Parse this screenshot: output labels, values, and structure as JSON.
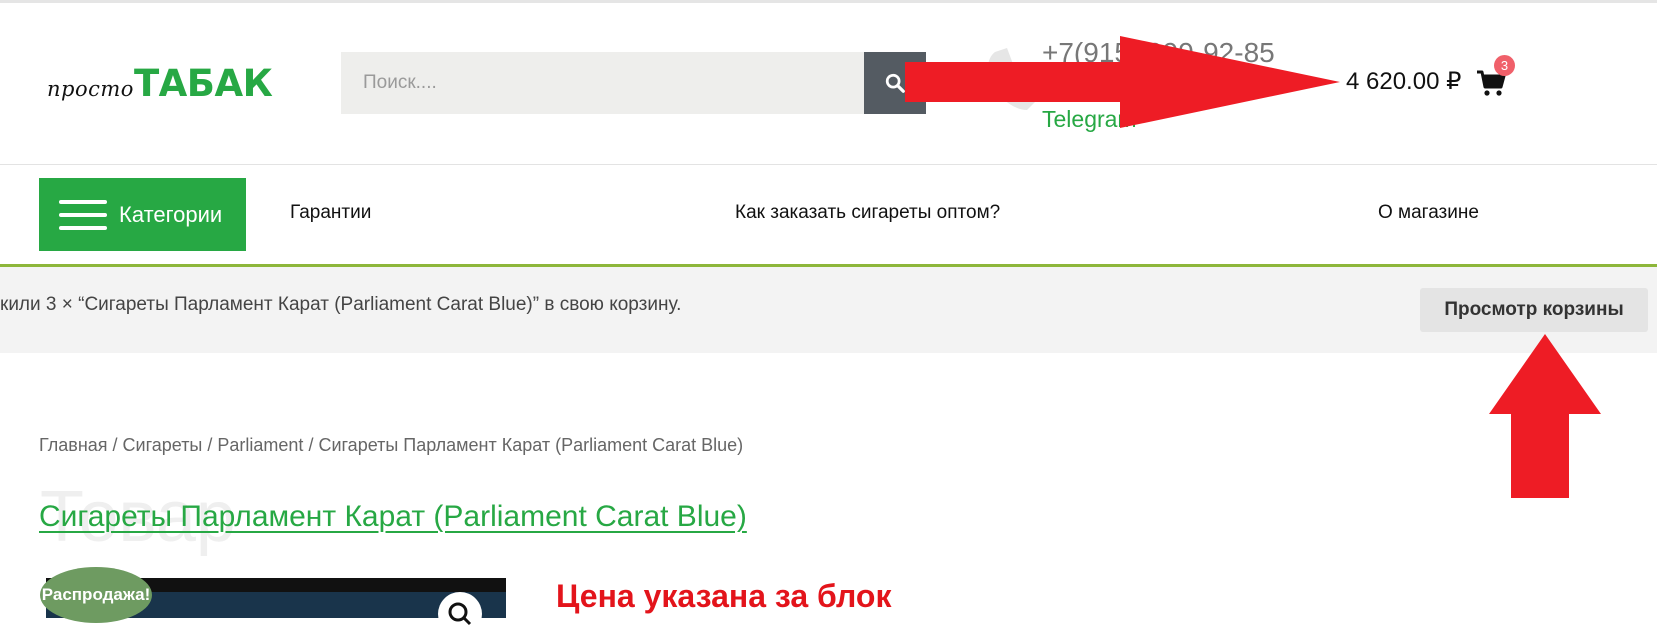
{
  "header": {
    "logo_small": "просто",
    "logo_big": "ТАБАК",
    "search_placeholder": "Поиск....",
    "phone": "+7(915) 999-92-85",
    "telegram": "Telegram",
    "cart_total": "4 620.00 ₽",
    "cart_count": "3"
  },
  "nav": {
    "categories": "Категории",
    "items": [
      "Гарантии",
      "Как заказать сигареты оптом?",
      "О магазине"
    ]
  },
  "notice": {
    "text": "кили 3 × “Сигареты Парламент Карат (Parliament Carat Blue)” в свою корзину.",
    "button": "Просмотр корзины"
  },
  "breadcrumb": {
    "items": [
      "Главная",
      "Сигареты",
      "Parliament",
      "Сигареты Парламент Карат (Parliament Carat Blue)"
    ],
    "separator": " / "
  },
  "product": {
    "ghost": "Товар",
    "title": "Сигареты Парламент Карат (Parliament Carat Blue)",
    "sale_badge": "Распродажа!",
    "price_note": "Цена указана за блок"
  },
  "colors": {
    "brand_green": "#27a844",
    "annotation_red": "#ee1c25",
    "badge_red": "#f0606a"
  }
}
